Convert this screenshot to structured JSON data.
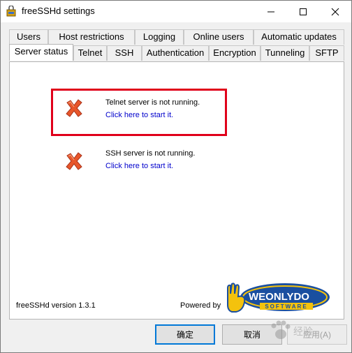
{
  "window": {
    "title": "freeSSHd settings",
    "icon": "freesshd-app-icon"
  },
  "tabs": {
    "row_back": [
      "Users",
      "Host restrictions",
      "Logging",
      "Online users",
      "Automatic updates"
    ],
    "row_front": [
      "Server status",
      "Telnet",
      "SSH",
      "Authentication",
      "Encryption",
      "Tunneling",
      "SFTP"
    ],
    "active": "Server status"
  },
  "status": {
    "telnet": {
      "text": "Telnet server is not running.",
      "link": "Click here to start it."
    },
    "ssh": {
      "text": "SSH server is not running.",
      "link": "Click here to start it."
    }
  },
  "footer": {
    "version": "freeSSHd version 1.3.1",
    "powered_by": "Powered by",
    "logo_text": "WEONLYDO",
    "logo_subtext": "SOFTWARE"
  },
  "buttons": {
    "ok": "确定",
    "cancel": "取消",
    "apply": "应用(A)"
  },
  "watermark": {
    "text": "经验"
  },
  "colors": {
    "highlight": "#e0001a",
    "link": "#0000cc",
    "x_icon": "#e8562a",
    "logo_blue": "#1a4fa0",
    "logo_yellow": "#f4c20d"
  }
}
